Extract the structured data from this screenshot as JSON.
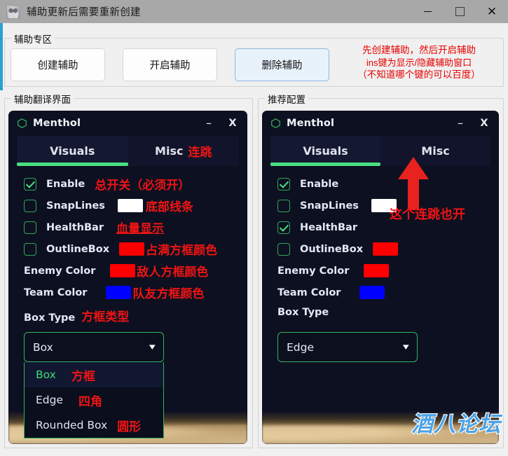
{
  "window": {
    "title": "辅助更新后需要重新创建",
    "icon": "cat-app-icon",
    "controls": {
      "minimize": "—",
      "maximize": "☐",
      "close": "✕"
    }
  },
  "helper_group": {
    "title": "辅助专区",
    "buttons": [
      {
        "label": "创建辅助",
        "name": "create-helper-button"
      },
      {
        "label": "开启辅助",
        "name": "start-helper-button"
      },
      {
        "label": "删除辅助",
        "name": "delete-helper-button",
        "focused": true
      }
    ],
    "instructions": {
      "line1": "先创建辅助，然后开启辅助",
      "line2": "ins键为显示/隐藏辅助窗口",
      "line3": "（不知道哪个键的可以百度）",
      "color": "#e80000"
    }
  },
  "left_group": {
    "title": "辅助翻译界面"
  },
  "right_group": {
    "title": "推荐配置"
  },
  "left_panel": {
    "app_name": "Menthol",
    "minimize": "–",
    "close": "X",
    "tabs": [
      {
        "label": "Visuals",
        "active": true,
        "annotation": ""
      },
      {
        "label": "Misc",
        "active": false,
        "annotation": "连跳"
      }
    ],
    "options": [
      {
        "label": "Enable",
        "checked": true,
        "swatch": "",
        "annotation": "总开关（必须开）",
        "underline": false
      },
      {
        "label": "SnapLines",
        "checked": false,
        "swatch": "#ffffff",
        "annotation": "底部线条",
        "underline": false
      },
      {
        "label": "HealthBar",
        "checked": false,
        "swatch": "",
        "annotation": "血量显示",
        "underline": true
      },
      {
        "label": "OutlineBox",
        "checked": false,
        "swatch": "#ff0000",
        "annotation": "占满方框颜色",
        "underline": false
      }
    ],
    "colors": [
      {
        "label": "Enemy Color",
        "swatch": "#ff0000",
        "annotation": "敌人方框颜色"
      },
      {
        "label": "Team Color",
        "swatch": "#0000ff",
        "annotation": "队友方框颜色"
      }
    ],
    "box_type": {
      "label": "Box Type",
      "annotation": "方框类型",
      "value": "Box",
      "open": true,
      "options": [
        {
          "label": "Box",
          "annotation": "方框",
          "selected": true
        },
        {
          "label": "Edge",
          "annotation": "四角",
          "selected": false
        },
        {
          "label": "Rounded Box",
          "annotation": "圆形",
          "selected": false
        }
      ]
    }
  },
  "right_panel": {
    "app_name": "Menthol",
    "minimize": "–",
    "close": "X",
    "tabs": [
      {
        "label": "Visuals",
        "active": true
      },
      {
        "label": "Misc",
        "active": false
      }
    ],
    "arrow_annotation": "这个连跳也开",
    "options": [
      {
        "label": "Enable",
        "checked": true,
        "swatch": ""
      },
      {
        "label": "SnapLines",
        "checked": false,
        "swatch": "#ffffff"
      },
      {
        "label": "HealthBar",
        "checked": true,
        "swatch": ""
      },
      {
        "label": "OutlineBox",
        "checked": false,
        "swatch": "#ff0000"
      }
    ],
    "colors": [
      {
        "label": "Enemy Color",
        "swatch": "#ff0000"
      },
      {
        "label": "Team Color",
        "swatch": "#0000ff"
      }
    ],
    "box_type": {
      "label": "Box Type",
      "value": "Edge",
      "open": false
    }
  },
  "watermark": "酒八论坛",
  "theme": {
    "panel_bg": "#0d1020",
    "accent_green": "#4ade80",
    "annotation_red": "#ee1414",
    "title_bar": "#a8a8a8",
    "window_bg": "#f0f0f0",
    "left_edge_accent": "#2a9fd6"
  }
}
